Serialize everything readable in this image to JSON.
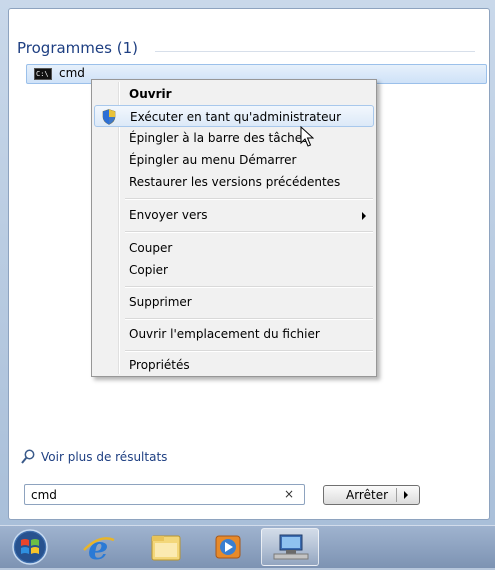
{
  "start_menu": {
    "section_header": "Programmes (1)",
    "result_item": {
      "label": "cmd",
      "icon": "cmd-icon",
      "icon_text": "C:\\"
    },
    "see_more": {
      "label": "Voir plus de résultats",
      "icon": "search-icon"
    },
    "search": {
      "value": "cmd",
      "clear_symbol": "×"
    },
    "stop_button": {
      "label": "Arrêter"
    }
  },
  "context_menu": {
    "items": [
      {
        "label": "Ouvrir",
        "bold": true
      },
      {
        "label": "Exécuter en tant qu'administrateur",
        "icon": "uac-shield-icon",
        "hovered": true
      },
      {
        "label": "Épingler à la barre des tâches"
      },
      {
        "label": "Épingler au menu Démarrer"
      },
      {
        "label": "Restaurer les versions précédentes"
      },
      {
        "label": "Envoyer vers",
        "submenu": true
      },
      {
        "label": "Couper"
      },
      {
        "label": "Copier"
      },
      {
        "label": "Supprimer"
      },
      {
        "label": "Ouvrir l'emplacement du fichier"
      },
      {
        "label": "Propriétés"
      }
    ]
  },
  "taskbar": {
    "items": [
      {
        "name": "windows-start-orb-icon"
      },
      {
        "name": "internet-explorer-icon"
      },
      {
        "name": "file-explorer-icon"
      },
      {
        "name": "media-player-icon"
      },
      {
        "name": "network-computer-icon",
        "active": true
      }
    ]
  },
  "colors": {
    "accent_text": "#1e3f82",
    "highlight_border": "#a8c8ec"
  }
}
